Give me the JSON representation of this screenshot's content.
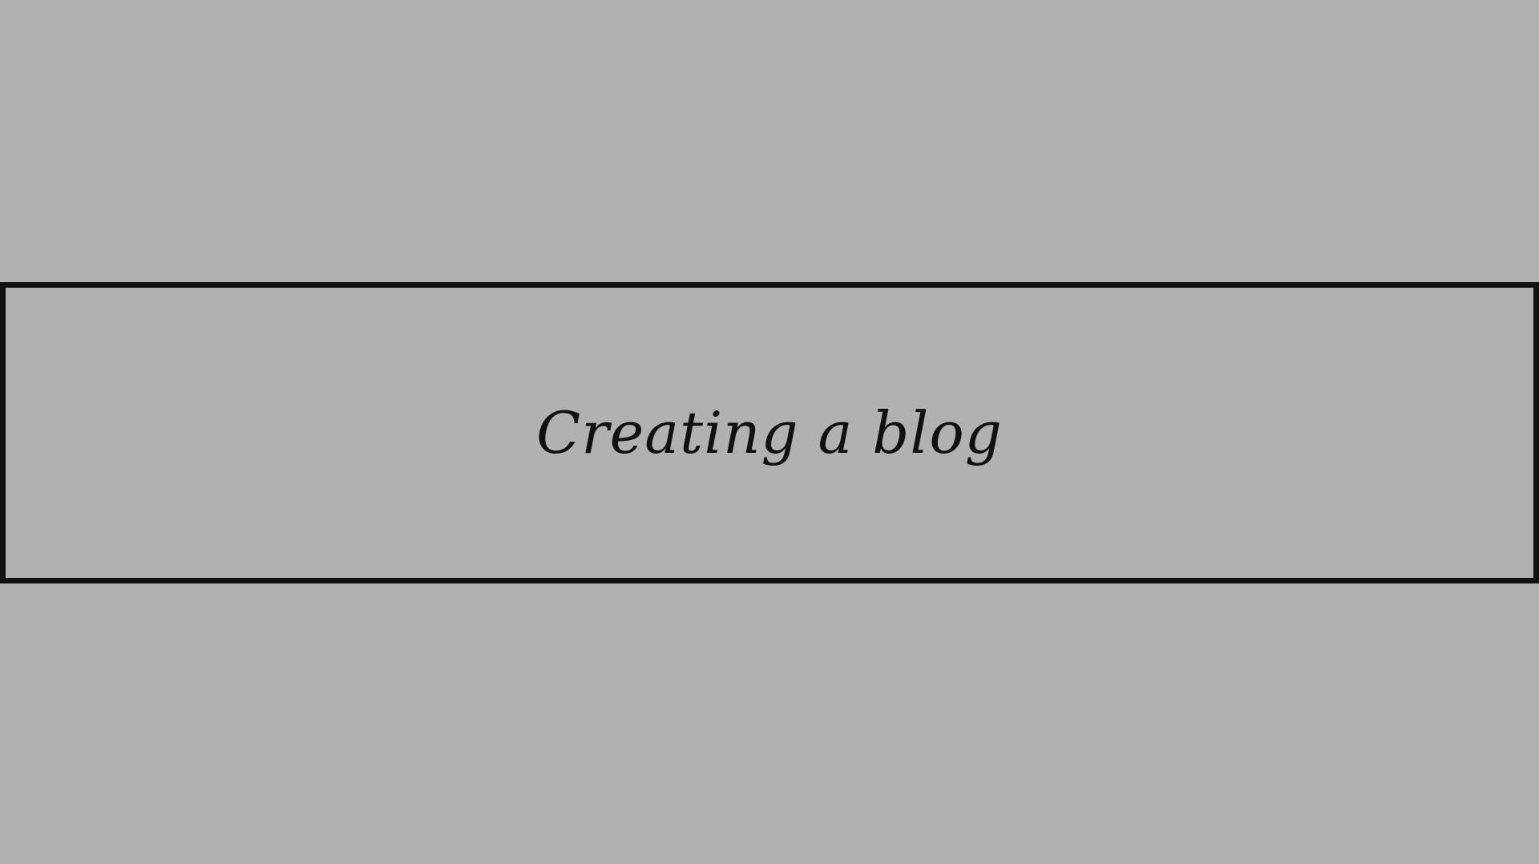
{
  "slide": {
    "background_color": "#b1b1b1",
    "border_color": "#111111",
    "title": "Creating a blog"
  }
}
